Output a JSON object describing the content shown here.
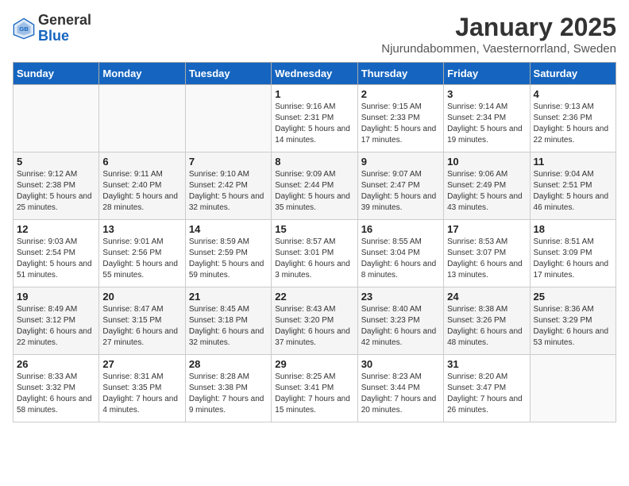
{
  "header": {
    "logo_general": "General",
    "logo_blue": "Blue",
    "title": "January 2025",
    "subtitle": "Njurundabommen, Vaesternorrland, Sweden"
  },
  "weekdays": [
    "Sunday",
    "Monday",
    "Tuesday",
    "Wednesday",
    "Thursday",
    "Friday",
    "Saturday"
  ],
  "weeks": [
    [
      {
        "day": "",
        "sunrise": "",
        "sunset": "",
        "daylight": ""
      },
      {
        "day": "",
        "sunrise": "",
        "sunset": "",
        "daylight": ""
      },
      {
        "day": "",
        "sunrise": "",
        "sunset": "",
        "daylight": ""
      },
      {
        "day": "1",
        "sunrise": "Sunrise: 9:16 AM",
        "sunset": "Sunset: 2:31 PM",
        "daylight": "Daylight: 5 hours and 14 minutes."
      },
      {
        "day": "2",
        "sunrise": "Sunrise: 9:15 AM",
        "sunset": "Sunset: 2:33 PM",
        "daylight": "Daylight: 5 hours and 17 minutes."
      },
      {
        "day": "3",
        "sunrise": "Sunrise: 9:14 AM",
        "sunset": "Sunset: 2:34 PM",
        "daylight": "Daylight: 5 hours and 19 minutes."
      },
      {
        "day": "4",
        "sunrise": "Sunrise: 9:13 AM",
        "sunset": "Sunset: 2:36 PM",
        "daylight": "Daylight: 5 hours and 22 minutes."
      }
    ],
    [
      {
        "day": "5",
        "sunrise": "Sunrise: 9:12 AM",
        "sunset": "Sunset: 2:38 PM",
        "daylight": "Daylight: 5 hours and 25 minutes."
      },
      {
        "day": "6",
        "sunrise": "Sunrise: 9:11 AM",
        "sunset": "Sunset: 2:40 PM",
        "daylight": "Daylight: 5 hours and 28 minutes."
      },
      {
        "day": "7",
        "sunrise": "Sunrise: 9:10 AM",
        "sunset": "Sunset: 2:42 PM",
        "daylight": "Daylight: 5 hours and 32 minutes."
      },
      {
        "day": "8",
        "sunrise": "Sunrise: 9:09 AM",
        "sunset": "Sunset: 2:44 PM",
        "daylight": "Daylight: 5 hours and 35 minutes."
      },
      {
        "day": "9",
        "sunrise": "Sunrise: 9:07 AM",
        "sunset": "Sunset: 2:47 PM",
        "daylight": "Daylight: 5 hours and 39 minutes."
      },
      {
        "day": "10",
        "sunrise": "Sunrise: 9:06 AM",
        "sunset": "Sunset: 2:49 PM",
        "daylight": "Daylight: 5 hours and 43 minutes."
      },
      {
        "day": "11",
        "sunrise": "Sunrise: 9:04 AM",
        "sunset": "Sunset: 2:51 PM",
        "daylight": "Daylight: 5 hours and 46 minutes."
      }
    ],
    [
      {
        "day": "12",
        "sunrise": "Sunrise: 9:03 AM",
        "sunset": "Sunset: 2:54 PM",
        "daylight": "Daylight: 5 hours and 51 minutes."
      },
      {
        "day": "13",
        "sunrise": "Sunrise: 9:01 AM",
        "sunset": "Sunset: 2:56 PM",
        "daylight": "Daylight: 5 hours and 55 minutes."
      },
      {
        "day": "14",
        "sunrise": "Sunrise: 8:59 AM",
        "sunset": "Sunset: 2:59 PM",
        "daylight": "Daylight: 5 hours and 59 minutes."
      },
      {
        "day": "15",
        "sunrise": "Sunrise: 8:57 AM",
        "sunset": "Sunset: 3:01 PM",
        "daylight": "Daylight: 6 hours and 3 minutes."
      },
      {
        "day": "16",
        "sunrise": "Sunrise: 8:55 AM",
        "sunset": "Sunset: 3:04 PM",
        "daylight": "Daylight: 6 hours and 8 minutes."
      },
      {
        "day": "17",
        "sunrise": "Sunrise: 8:53 AM",
        "sunset": "Sunset: 3:07 PM",
        "daylight": "Daylight: 6 hours and 13 minutes."
      },
      {
        "day": "18",
        "sunrise": "Sunrise: 8:51 AM",
        "sunset": "Sunset: 3:09 PM",
        "daylight": "Daylight: 6 hours and 17 minutes."
      }
    ],
    [
      {
        "day": "19",
        "sunrise": "Sunrise: 8:49 AM",
        "sunset": "Sunset: 3:12 PM",
        "daylight": "Daylight: 6 hours and 22 minutes."
      },
      {
        "day": "20",
        "sunrise": "Sunrise: 8:47 AM",
        "sunset": "Sunset: 3:15 PM",
        "daylight": "Daylight: 6 hours and 27 minutes."
      },
      {
        "day": "21",
        "sunrise": "Sunrise: 8:45 AM",
        "sunset": "Sunset: 3:18 PM",
        "daylight": "Daylight: 6 hours and 32 minutes."
      },
      {
        "day": "22",
        "sunrise": "Sunrise: 8:43 AM",
        "sunset": "Sunset: 3:20 PM",
        "daylight": "Daylight: 6 hours and 37 minutes."
      },
      {
        "day": "23",
        "sunrise": "Sunrise: 8:40 AM",
        "sunset": "Sunset: 3:23 PM",
        "daylight": "Daylight: 6 hours and 42 minutes."
      },
      {
        "day": "24",
        "sunrise": "Sunrise: 8:38 AM",
        "sunset": "Sunset: 3:26 PM",
        "daylight": "Daylight: 6 hours and 48 minutes."
      },
      {
        "day": "25",
        "sunrise": "Sunrise: 8:36 AM",
        "sunset": "Sunset: 3:29 PM",
        "daylight": "Daylight: 6 hours and 53 minutes."
      }
    ],
    [
      {
        "day": "26",
        "sunrise": "Sunrise: 8:33 AM",
        "sunset": "Sunset: 3:32 PM",
        "daylight": "Daylight: 6 hours and 58 minutes."
      },
      {
        "day": "27",
        "sunrise": "Sunrise: 8:31 AM",
        "sunset": "Sunset: 3:35 PM",
        "daylight": "Daylight: 7 hours and 4 minutes."
      },
      {
        "day": "28",
        "sunrise": "Sunrise: 8:28 AM",
        "sunset": "Sunset: 3:38 PM",
        "daylight": "Daylight: 7 hours and 9 minutes."
      },
      {
        "day": "29",
        "sunrise": "Sunrise: 8:25 AM",
        "sunset": "Sunset: 3:41 PM",
        "daylight": "Daylight: 7 hours and 15 minutes."
      },
      {
        "day": "30",
        "sunrise": "Sunrise: 8:23 AM",
        "sunset": "Sunset: 3:44 PM",
        "daylight": "Daylight: 7 hours and 20 minutes."
      },
      {
        "day": "31",
        "sunrise": "Sunrise: 8:20 AM",
        "sunset": "Sunset: 3:47 PM",
        "daylight": "Daylight: 7 hours and 26 minutes."
      },
      {
        "day": "",
        "sunrise": "",
        "sunset": "",
        "daylight": ""
      }
    ]
  ]
}
